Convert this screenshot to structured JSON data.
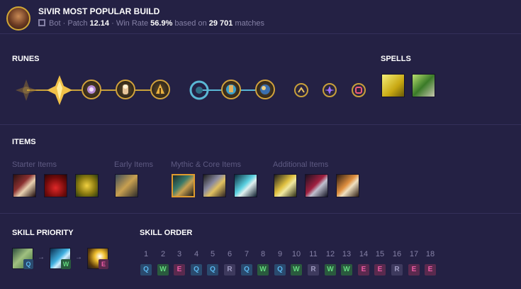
{
  "header": {
    "title": "SIVIR MOST POPULAR BUILD",
    "lane": "Bot",
    "patch_label": "Patch",
    "patch": "12.14",
    "win_rate_label": "Win Rate",
    "win_rate": "56.9%",
    "based_on": "based on",
    "matches_count": "29 701",
    "matches_label": "matches",
    "separator": "·"
  },
  "runes": {
    "title": "RUNES",
    "primary_tree": "precision",
    "primary": [
      "lethal-tempo-keystone",
      "conqueror-keystone",
      "triumph-rune",
      "legend-alacrity-rune",
      "cut-down-rune"
    ],
    "secondary": [
      "inspiration-rune",
      "biscuit-delivery-rune",
      "cosmic-insight-rune"
    ],
    "shards": [
      "attack-speed-shard",
      "adaptive-force-shard",
      "armor-shard"
    ]
  },
  "spells": {
    "title": "SPELLS",
    "items": [
      "flash-spell",
      "heal-spell"
    ]
  },
  "items": {
    "title": "ITEMS",
    "groups": {
      "starter": "Starter Items",
      "early": "Early Items",
      "core": "Mythic & Core Items",
      "additional": "Additional Items"
    },
    "starter_items": [
      "dorans-blade",
      "health-potion",
      "stealth-ward"
    ],
    "early_items": [
      "pickaxe"
    ],
    "core_items": [
      "immortal-shieldbow",
      "berserkers-greaves",
      "navori-quickblades"
    ],
    "additional_items": [
      "essence-reaver",
      "serpents-fang",
      "infinity-edge"
    ]
  },
  "skill_priority": {
    "title": "SKILL PRIORITY",
    "order": [
      "Q",
      "W",
      "E"
    ],
    "arrow": "→"
  },
  "skill_order": {
    "title": "SKILL ORDER",
    "levels": [
      "1",
      "2",
      "3",
      "4",
      "5",
      "6",
      "7",
      "8",
      "9",
      "10",
      "11",
      "12",
      "13",
      "14",
      "15",
      "16",
      "17",
      "18"
    ],
    "keys": [
      "Q",
      "W",
      "E",
      "Q",
      "Q",
      "R",
      "Q",
      "W",
      "Q",
      "W",
      "R",
      "W",
      "W",
      "E",
      "E",
      "R",
      "E",
      "E"
    ]
  },
  "colors": {
    "background": "#242144",
    "gold": "#c8a03a",
    "q": "#5ab7ee",
    "w": "#62d97e",
    "e": "#ef5aa6",
    "r": "#9e9ac0"
  }
}
